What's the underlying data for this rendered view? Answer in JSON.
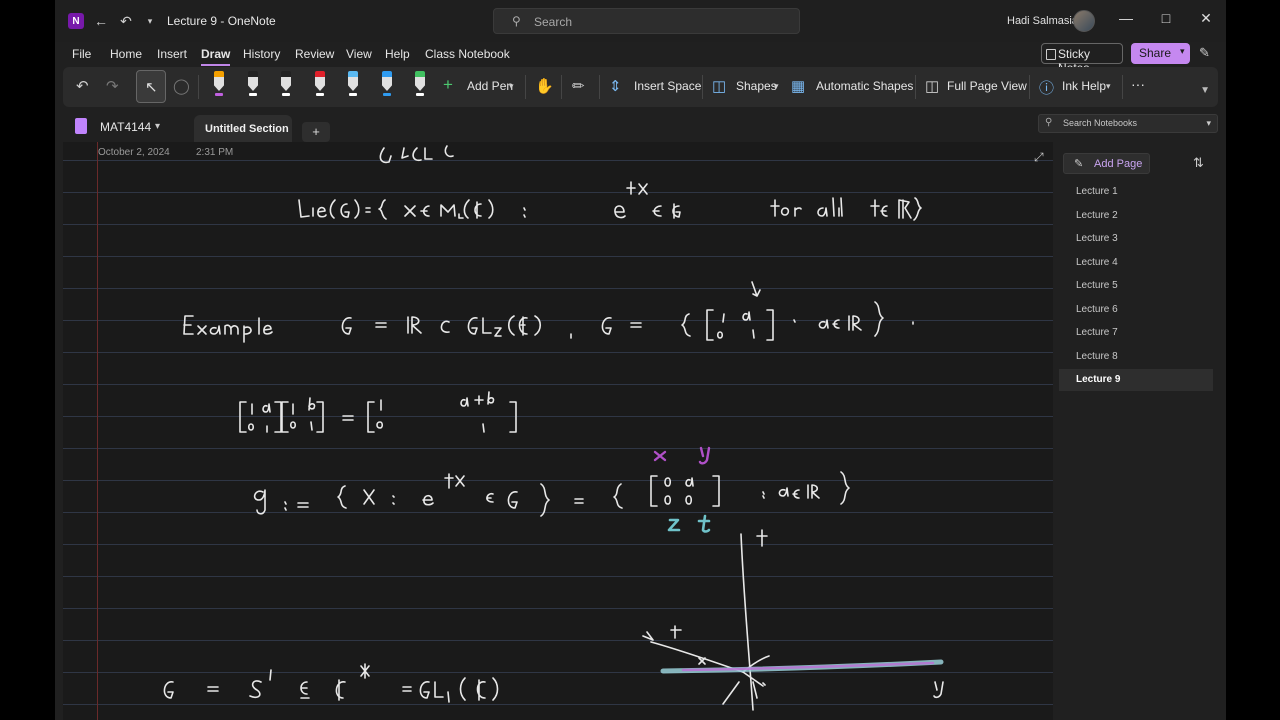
{
  "window": {
    "title": "Lecture 9  -  OneNote",
    "app_letter": "N",
    "search_placeholder": "Search",
    "user_name": "Hadi Salmasian"
  },
  "menu": [
    "File",
    "Home",
    "Insert",
    "Draw",
    "History",
    "Review",
    "View",
    "Help",
    "Class Notebook"
  ],
  "menu_active": "Draw",
  "actions": {
    "sticky_notes": "Sticky Notes",
    "share": "Share"
  },
  "ribbon": {
    "add_pen": "Add Pen",
    "insert_space": "Insert Space",
    "shapes": "Shapes",
    "automatic_shapes": "Automatic Shapes",
    "full_page_view": "Full Page View",
    "ink_help": "Ink Help",
    "more": "···",
    "pens": [
      {
        "cap": "#f4a000",
        "mark": "#c060e0"
      },
      {
        "cap": "#222222",
        "mark": "#ffffff"
      },
      {
        "cap": "#222222",
        "mark": "#ffffff"
      },
      {
        "cap": "#e0202a",
        "mark": "#ffffff"
      },
      {
        "cap": "#5ab8f0",
        "mark": "#ffffff"
      },
      {
        "cap": "#2f9bf0",
        "mark": "#2f9bf0"
      },
      {
        "cap": "#40c060",
        "mark": "#ffffff"
      }
    ]
  },
  "notebook": {
    "name": "MAT4144",
    "section": "Untitled Section",
    "add_section": "+",
    "search_placeholder": "Search Notebooks"
  },
  "page": {
    "date": "October 2, 2024",
    "time": "2:31 PM"
  },
  "page_list": {
    "add_page": "Add Page",
    "pages": [
      "Lecture 1",
      "Lecture 2",
      "Lecture 3",
      "Lecture 4",
      "Lecture 5",
      "Lecture 6",
      "Lecture 7",
      "Lecture 8",
      "Lecture 9"
    ],
    "selected": "Lecture 9"
  },
  "colors": {
    "accent": "#c588f0",
    "ink": "#e8e8e8",
    "ink_purple": "#b050c8",
    "ink_teal": "#6fc2c9",
    "rule": "#2f3645",
    "margin": "#6a2a2a"
  }
}
